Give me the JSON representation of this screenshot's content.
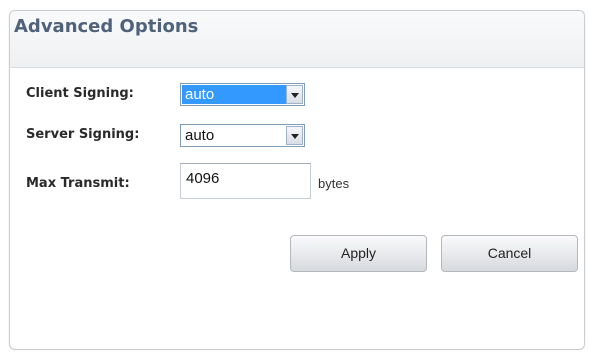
{
  "panel": {
    "title": "Advanced Options"
  },
  "fields": {
    "client_signing": {
      "label": "Client Signing:",
      "value": "auto",
      "selected": true
    },
    "server_signing": {
      "label": "Server Signing:",
      "value": "auto"
    },
    "max_transmit": {
      "label": "Max Transmit:",
      "value": "4096",
      "unit": "bytes"
    }
  },
  "buttons": {
    "apply_label": "Apply",
    "cancel_label": "Cancel"
  },
  "colors": {
    "title": "#50627a",
    "selection_highlight": "#3399ff",
    "select_border": "#7f9db9"
  },
  "icons": {
    "dropdown": "chevron-down-icon"
  }
}
